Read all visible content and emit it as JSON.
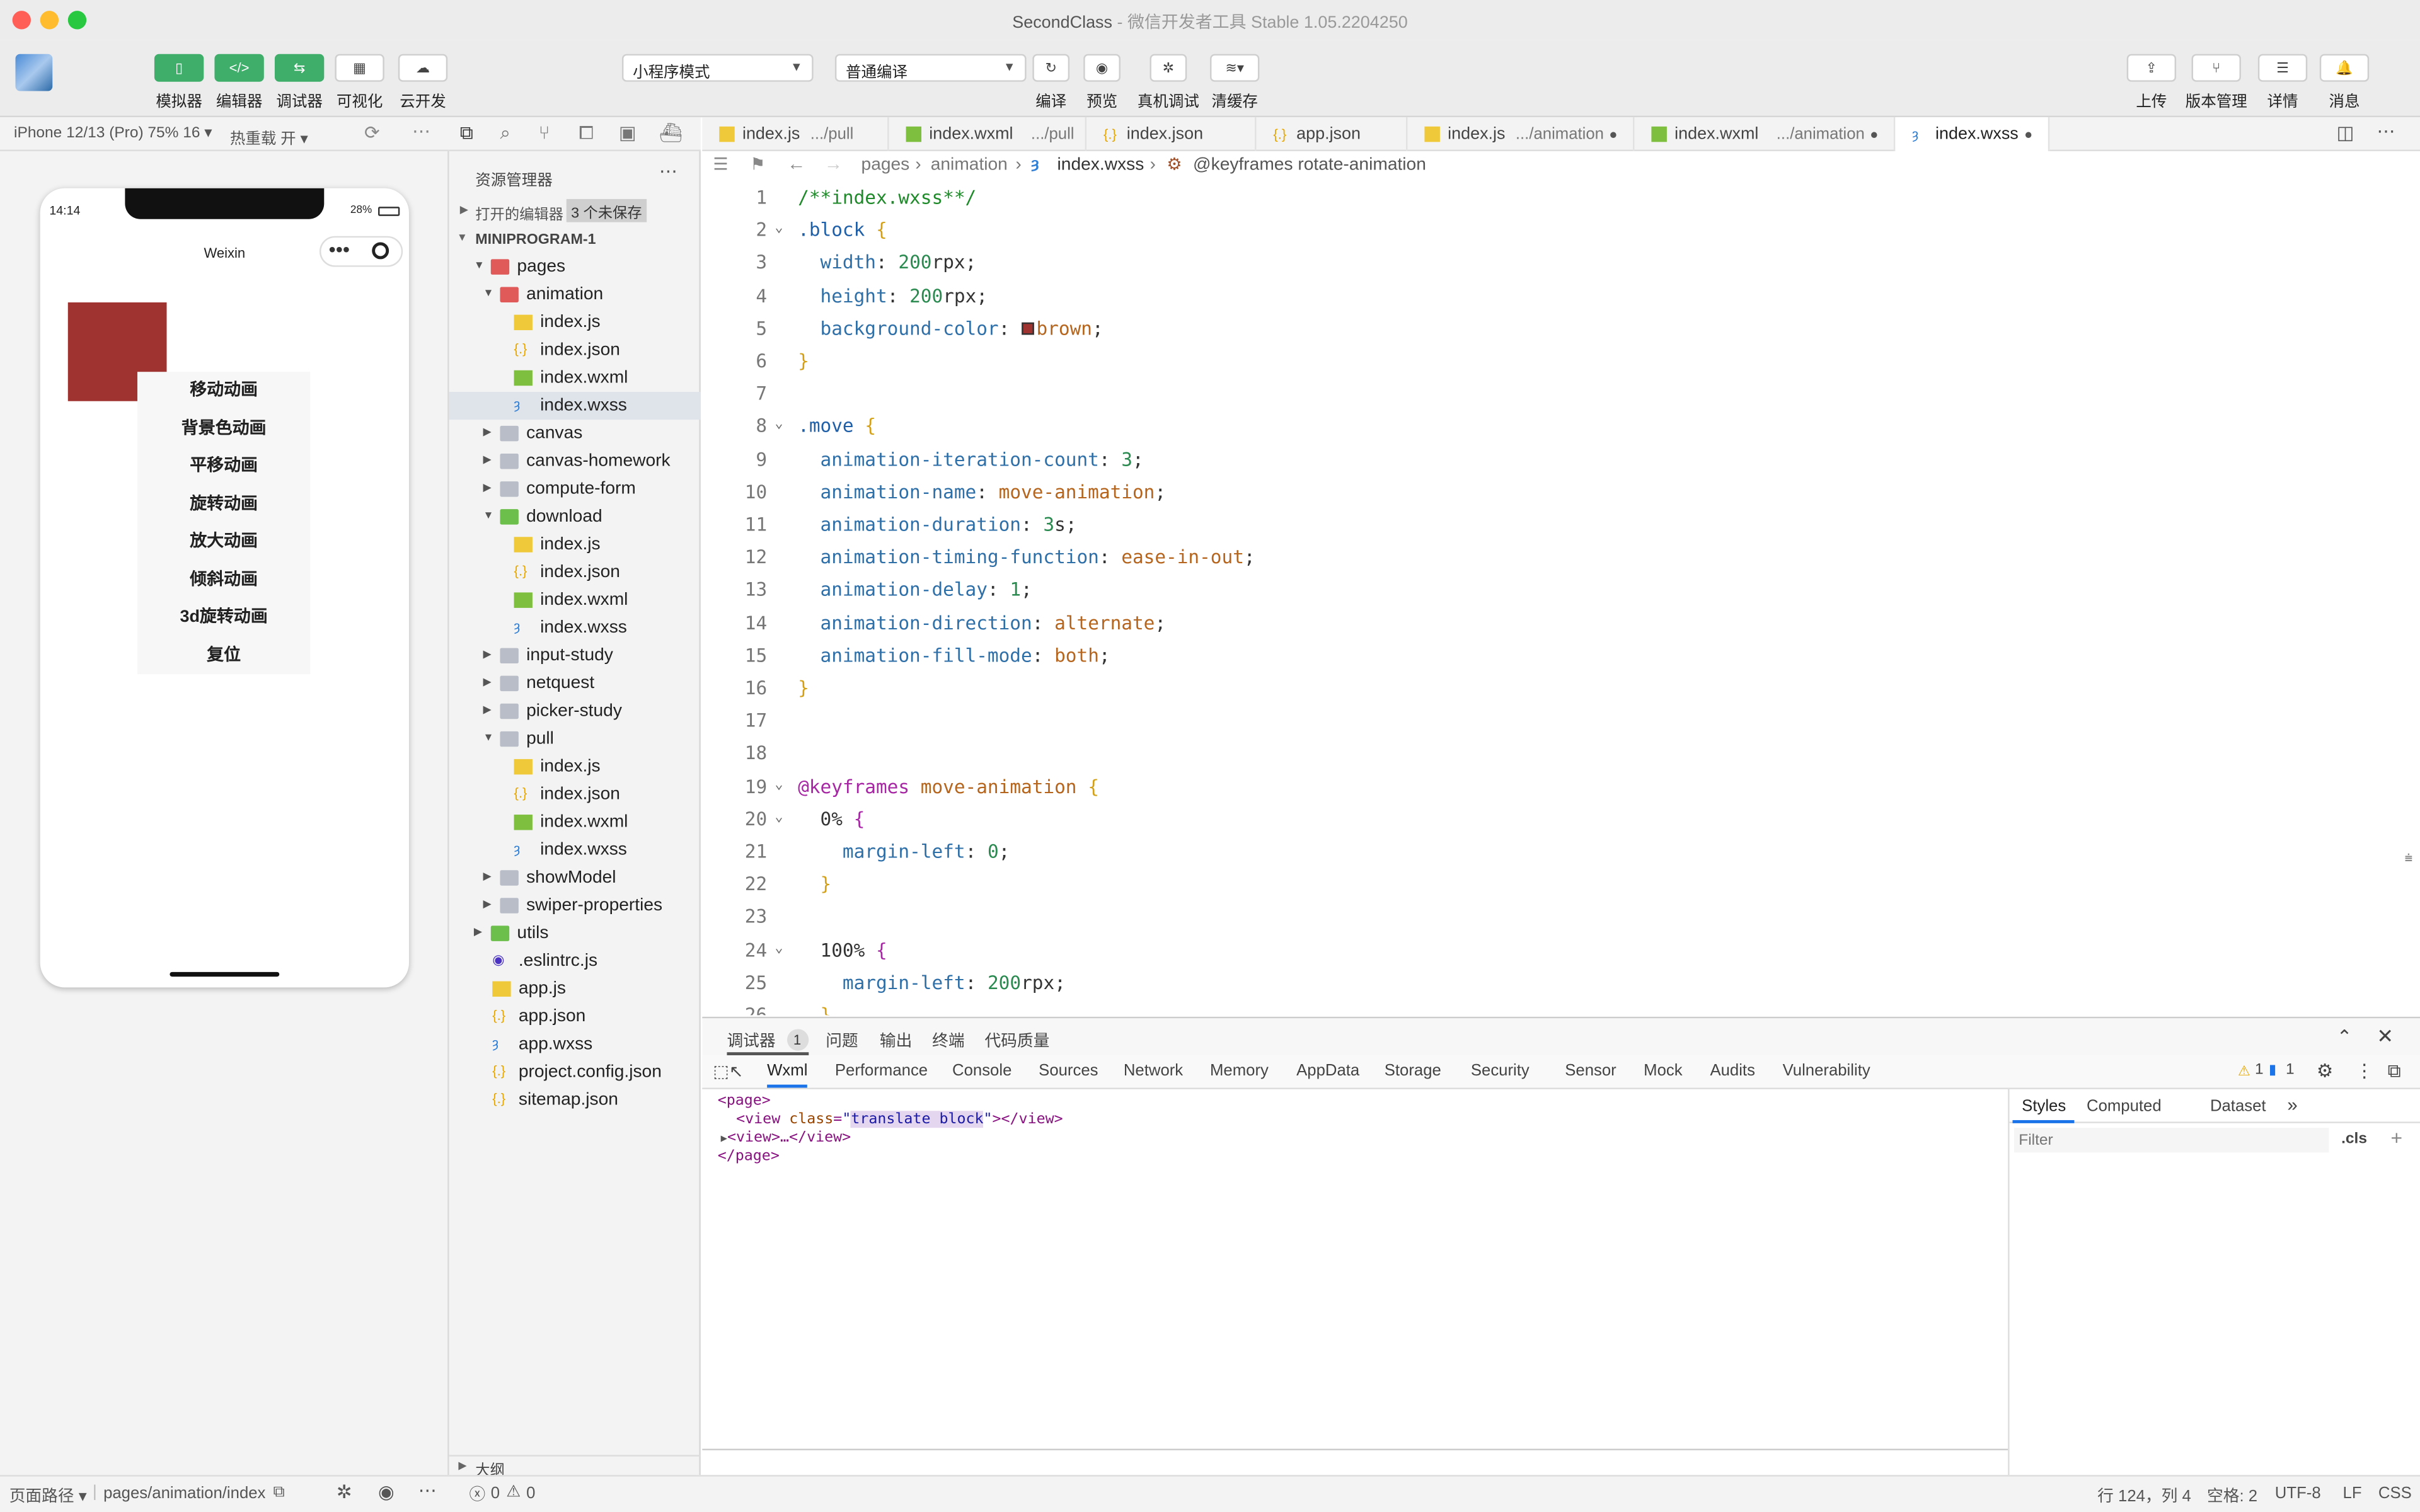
{
  "window": {
    "title": "SecondClass",
    "subtitle": " - 微信开发者工具 Stable 1.05.2204250"
  },
  "toolbar": {
    "simulator": "模拟器",
    "editor": "编辑器",
    "debugger": "调试器",
    "visual": "可视化",
    "cloud": "云开发",
    "mode_select": "小程序模式",
    "compile_select": "普通编译",
    "compile": "编译",
    "preview": "预览",
    "real_debug": "真机调试",
    "clear_cache": "清缓存",
    "upload": "上传",
    "version": "版本管理",
    "details": "详情",
    "messages": "消息"
  },
  "simbar": {
    "device": "iPhone 12/13 (Pro) 75% 16 ▾",
    "hot_reload": "热重载 开 ▾"
  },
  "phone": {
    "time": "14:14",
    "battery": "28%",
    "nav_title": "Weixin",
    "block_color": "#9e3330",
    "menu": [
      "移动动画",
      "背景色动画",
      "平移动画",
      "旋转动画",
      "放大动画",
      "倾斜动画",
      "3d旋转动画",
      "复位"
    ]
  },
  "explorer": {
    "title": "资源管理器",
    "open_editors": "打开的编辑器",
    "unsaved": "3 个未保存",
    "project": "MINIPROGRAM-1",
    "outline": "大纲",
    "tree": [
      {
        "label": "pages",
        "type": "folder-red",
        "depth": 1,
        "open": true
      },
      {
        "label": "animation",
        "type": "folder-red",
        "depth": 2,
        "open": true
      },
      {
        "label": "index.js",
        "type": "js",
        "depth": 3
      },
      {
        "label": "index.json",
        "type": "json",
        "depth": 3
      },
      {
        "label": "index.wxml",
        "type": "wxml",
        "depth": 3
      },
      {
        "label": "index.wxss",
        "type": "wxss",
        "depth": 3,
        "selected": true
      },
      {
        "label": "canvas",
        "type": "folder",
        "depth": 2,
        "open": false
      },
      {
        "label": "canvas-homework",
        "type": "folder",
        "depth": 2,
        "open": false
      },
      {
        "label": "compute-form",
        "type": "folder",
        "depth": 2,
        "open": false
      },
      {
        "label": "download",
        "type": "folder-green",
        "depth": 2,
        "open": true
      },
      {
        "label": "index.js",
        "type": "js",
        "depth": 3
      },
      {
        "label": "index.json",
        "type": "json",
        "depth": 3
      },
      {
        "label": "index.wxml",
        "type": "wxml",
        "depth": 3
      },
      {
        "label": "index.wxss",
        "type": "wxss",
        "depth": 3
      },
      {
        "label": "input-study",
        "type": "folder",
        "depth": 2,
        "open": false
      },
      {
        "label": "netquest",
        "type": "folder",
        "depth": 2,
        "open": false
      },
      {
        "label": "picker-study",
        "type": "folder",
        "depth": 2,
        "open": false
      },
      {
        "label": "pull",
        "type": "folder",
        "depth": 2,
        "open": true
      },
      {
        "label": "index.js",
        "type": "js",
        "depth": 3
      },
      {
        "label": "index.json",
        "type": "json",
        "depth": 3
      },
      {
        "label": "index.wxml",
        "type": "wxml",
        "depth": 3
      },
      {
        "label": "index.wxss",
        "type": "wxss",
        "depth": 3
      },
      {
        "label": "showModel",
        "type": "folder",
        "depth": 2,
        "open": false
      },
      {
        "label": "swiper-properties",
        "type": "folder",
        "depth": 2,
        "open": false
      },
      {
        "label": "utils",
        "type": "folder-green",
        "depth": 1,
        "open": false
      },
      {
        "label": ".eslintrc.js",
        "type": "eslint",
        "depth": 1
      },
      {
        "label": "app.js",
        "type": "js",
        "depth": 1
      },
      {
        "label": "app.json",
        "type": "json",
        "depth": 1
      },
      {
        "label": "app.wxss",
        "type": "wxss",
        "depth": 1
      },
      {
        "label": "project.config.json",
        "type": "json",
        "depth": 1
      },
      {
        "label": "sitemap.json",
        "type": "json",
        "depth": 1
      }
    ]
  },
  "tabs": [
    {
      "name": "index.js",
      "path": ".../pull",
      "type": "js"
    },
    {
      "name": "index.wxml",
      "path": ".../pull",
      "type": "wxml"
    },
    {
      "name": "index.json",
      "path": "",
      "type": "json"
    },
    {
      "name": "app.json",
      "path": "",
      "type": "json"
    },
    {
      "name": "index.js",
      "path": ".../animation",
      "type": "js",
      "dirty": "●"
    },
    {
      "name": "index.wxml",
      "path": ".../animation",
      "type": "wxml",
      "dirty": "●"
    },
    {
      "name": "index.wxss",
      "path": "",
      "type": "wxss",
      "dirty": "●",
      "active": true
    }
  ],
  "breadcrumb": {
    "p1": "pages",
    "p2": "animation",
    "p3": "index.wxss",
    "p4": "@keyframes rotate-animation"
  },
  "code": [
    "/**index.wxss**/",
    ".block {",
    "  width: 200rpx;",
    "  height: 200rpx;",
    "  background-color: ■brown;",
    "}",
    "",
    ".move {",
    "  animation-iteration-count: 3;",
    "  animation-name: move-animation;",
    "  animation-duration: 3s;",
    "  animation-timing-function: ease-in-out;",
    "  animation-delay: 1;",
    "  animation-direction: alternate;",
    "  animation-fill-mode: both;",
    "}",
    "",
    "",
    "@keyframes move-animation {",
    "  0% {",
    "    margin-left: 0;",
    "  }",
    "",
    "  100% {",
    "    margin-left: 200rpx;",
    "  }"
  ],
  "debug": {
    "tabs_top": [
      "调试器",
      "问题",
      "输出",
      "终端",
      "代码质量"
    ],
    "badge": "1",
    "tabs": [
      "Wxml",
      "Performance",
      "Console",
      "Sources",
      "Network",
      "Memory",
      "AppData",
      "Storage",
      "Security",
      "Sensor",
      "Mock",
      "Audits",
      "Vulnerability"
    ],
    "warn_count": "1",
    "info_count": "1",
    "wxml": [
      "<page>",
      "<view class=\"translate block\"></view>",
      "<view>…</view>",
      "</page>"
    ],
    "side_tabs": [
      "Styles",
      "Computed",
      "Dataset"
    ],
    "filter_placeholder": "Filter",
    "cls": ".cls"
  },
  "status": {
    "path_label": "页面路径 ▾",
    "page_path": "pages/animation/index",
    "errors": "0",
    "warnings": "0",
    "position": "行 124，列 4",
    "spaces": "空格: 2",
    "encoding": "UTF-8",
    "eol": "LF",
    "lang": "CSS"
  }
}
